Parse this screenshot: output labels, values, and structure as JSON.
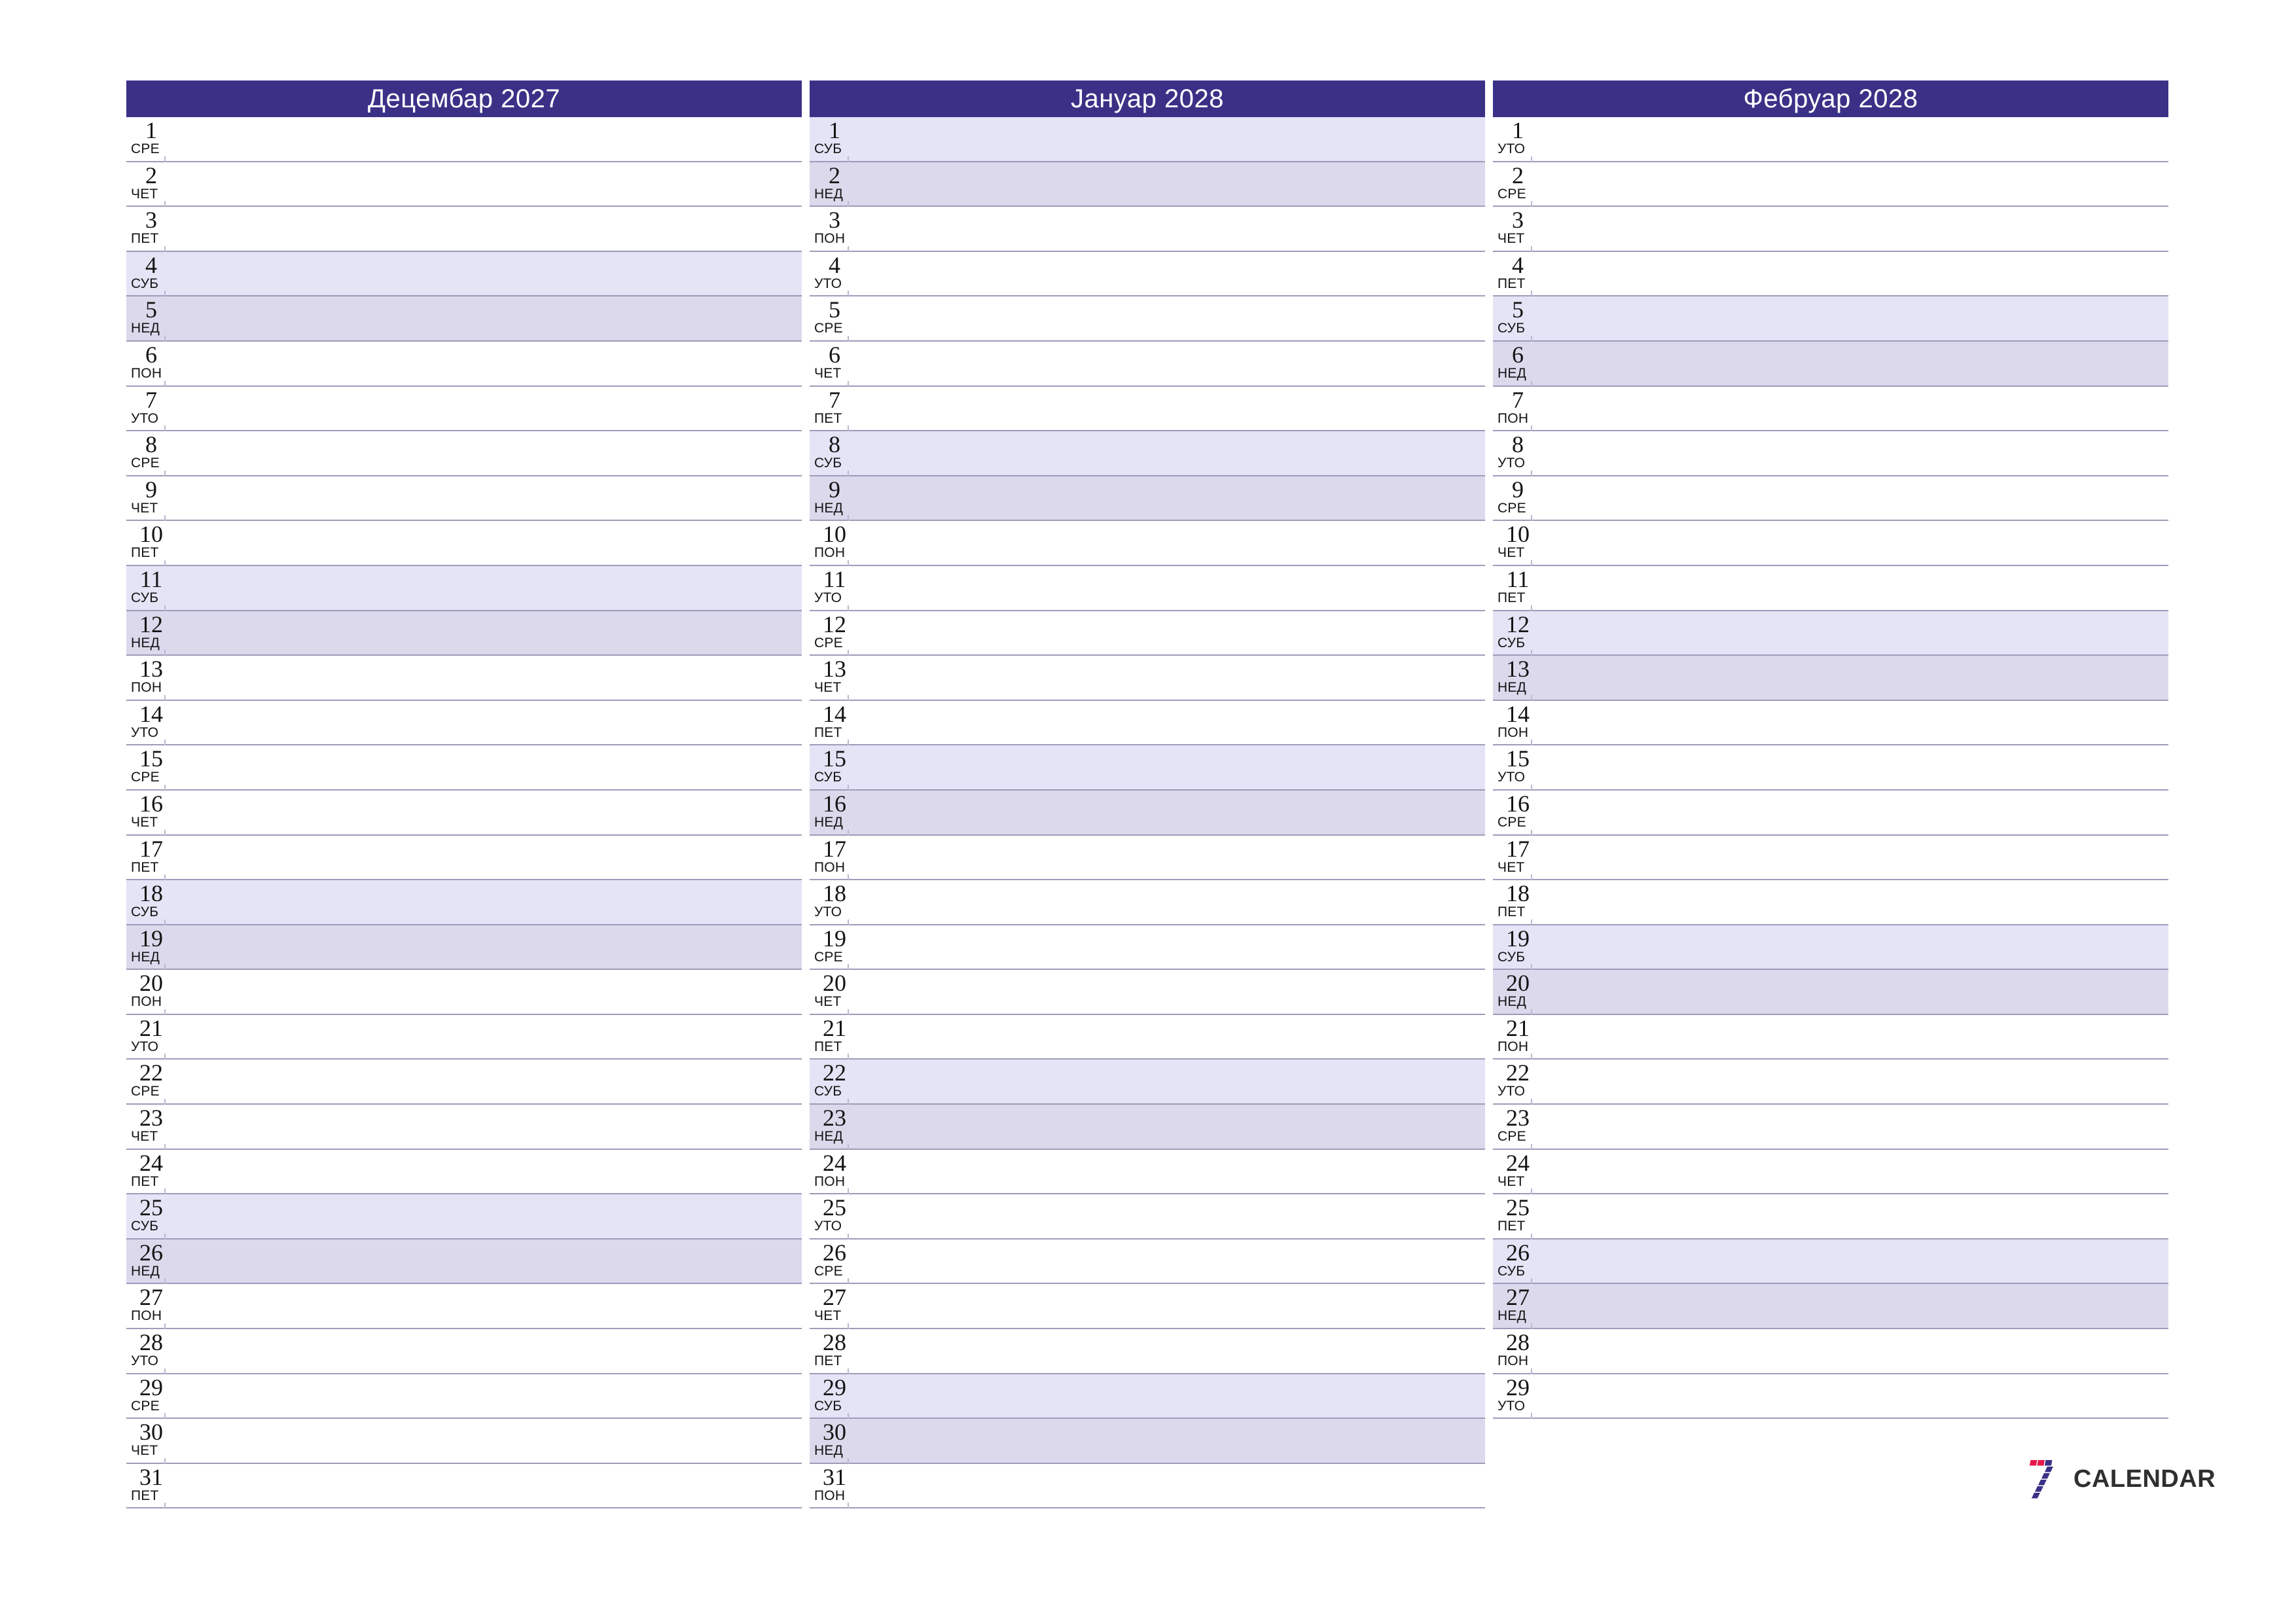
{
  "page": {
    "background": "#ffffff",
    "accent_header": "#3a3187",
    "saturday_tint": "#e4e4f6",
    "sunday_tint": "#dcd9ec",
    "rule_color": "#9c9cba"
  },
  "brand": {
    "name": "CALENDAR",
    "mark": "seven-logo-icon",
    "mark_colors": [
      "#e8174a",
      "#3a3187"
    ]
  },
  "months": [
    {
      "title": "Децембар 2027",
      "month_name": "Децембар",
      "year": "2027",
      "days": [
        {
          "num": "1",
          "dow": "СРЕ",
          "type": "weekday"
        },
        {
          "num": "2",
          "dow": "ЧЕТ",
          "type": "weekday"
        },
        {
          "num": "3",
          "dow": "ПЕТ",
          "type": "weekday"
        },
        {
          "num": "4",
          "dow": "СУБ",
          "type": "sat"
        },
        {
          "num": "5",
          "dow": "НЕД",
          "type": "sun"
        },
        {
          "num": "6",
          "dow": "ПОН",
          "type": "weekday"
        },
        {
          "num": "7",
          "dow": "УТО",
          "type": "weekday"
        },
        {
          "num": "8",
          "dow": "СРЕ",
          "type": "weekday"
        },
        {
          "num": "9",
          "dow": "ЧЕТ",
          "type": "weekday"
        },
        {
          "num": "10",
          "dow": "ПЕТ",
          "type": "weekday"
        },
        {
          "num": "11",
          "dow": "СУБ",
          "type": "sat"
        },
        {
          "num": "12",
          "dow": "НЕД",
          "type": "sun"
        },
        {
          "num": "13",
          "dow": "ПОН",
          "type": "weekday"
        },
        {
          "num": "14",
          "dow": "УТО",
          "type": "weekday"
        },
        {
          "num": "15",
          "dow": "СРЕ",
          "type": "weekday"
        },
        {
          "num": "16",
          "dow": "ЧЕТ",
          "type": "weekday"
        },
        {
          "num": "17",
          "dow": "ПЕТ",
          "type": "weekday"
        },
        {
          "num": "18",
          "dow": "СУБ",
          "type": "sat"
        },
        {
          "num": "19",
          "dow": "НЕД",
          "type": "sun"
        },
        {
          "num": "20",
          "dow": "ПОН",
          "type": "weekday"
        },
        {
          "num": "21",
          "dow": "УТО",
          "type": "weekday"
        },
        {
          "num": "22",
          "dow": "СРЕ",
          "type": "weekday"
        },
        {
          "num": "23",
          "dow": "ЧЕТ",
          "type": "weekday"
        },
        {
          "num": "24",
          "dow": "ПЕТ",
          "type": "weekday"
        },
        {
          "num": "25",
          "dow": "СУБ",
          "type": "sat"
        },
        {
          "num": "26",
          "dow": "НЕД",
          "type": "sun"
        },
        {
          "num": "27",
          "dow": "ПОН",
          "type": "weekday"
        },
        {
          "num": "28",
          "dow": "УТО",
          "type": "weekday"
        },
        {
          "num": "29",
          "dow": "СРЕ",
          "type": "weekday"
        },
        {
          "num": "30",
          "dow": "ЧЕТ",
          "type": "weekday"
        },
        {
          "num": "31",
          "dow": "ПЕТ",
          "type": "weekday"
        }
      ]
    },
    {
      "title": "Јануар 2028",
      "month_name": "Јануар",
      "year": "2028",
      "days": [
        {
          "num": "1",
          "dow": "СУБ",
          "type": "sat"
        },
        {
          "num": "2",
          "dow": "НЕД",
          "type": "sun"
        },
        {
          "num": "3",
          "dow": "ПОН",
          "type": "weekday"
        },
        {
          "num": "4",
          "dow": "УТО",
          "type": "weekday"
        },
        {
          "num": "5",
          "dow": "СРЕ",
          "type": "weekday"
        },
        {
          "num": "6",
          "dow": "ЧЕТ",
          "type": "weekday"
        },
        {
          "num": "7",
          "dow": "ПЕТ",
          "type": "weekday"
        },
        {
          "num": "8",
          "dow": "СУБ",
          "type": "sat"
        },
        {
          "num": "9",
          "dow": "НЕД",
          "type": "sun"
        },
        {
          "num": "10",
          "dow": "ПОН",
          "type": "weekday"
        },
        {
          "num": "11",
          "dow": "УТО",
          "type": "weekday"
        },
        {
          "num": "12",
          "dow": "СРЕ",
          "type": "weekday"
        },
        {
          "num": "13",
          "dow": "ЧЕТ",
          "type": "weekday"
        },
        {
          "num": "14",
          "dow": "ПЕТ",
          "type": "weekday"
        },
        {
          "num": "15",
          "dow": "СУБ",
          "type": "sat"
        },
        {
          "num": "16",
          "dow": "НЕД",
          "type": "sun"
        },
        {
          "num": "17",
          "dow": "ПОН",
          "type": "weekday"
        },
        {
          "num": "18",
          "dow": "УТО",
          "type": "weekday"
        },
        {
          "num": "19",
          "dow": "СРЕ",
          "type": "weekday"
        },
        {
          "num": "20",
          "dow": "ЧЕТ",
          "type": "weekday"
        },
        {
          "num": "21",
          "dow": "ПЕТ",
          "type": "weekday"
        },
        {
          "num": "22",
          "dow": "СУБ",
          "type": "sat"
        },
        {
          "num": "23",
          "dow": "НЕД",
          "type": "sun"
        },
        {
          "num": "24",
          "dow": "ПОН",
          "type": "weekday"
        },
        {
          "num": "25",
          "dow": "УТО",
          "type": "weekday"
        },
        {
          "num": "26",
          "dow": "СРЕ",
          "type": "weekday"
        },
        {
          "num": "27",
          "dow": "ЧЕТ",
          "type": "weekday"
        },
        {
          "num": "28",
          "dow": "ПЕТ",
          "type": "weekday"
        },
        {
          "num": "29",
          "dow": "СУБ",
          "type": "sat"
        },
        {
          "num": "30",
          "dow": "НЕД",
          "type": "sun"
        },
        {
          "num": "31",
          "dow": "ПОН",
          "type": "weekday"
        }
      ]
    },
    {
      "title": "Фебруар 2028",
      "month_name": "Фебруар",
      "year": "2028",
      "days": [
        {
          "num": "1",
          "dow": "УТО",
          "type": "weekday"
        },
        {
          "num": "2",
          "dow": "СРЕ",
          "type": "weekday"
        },
        {
          "num": "3",
          "dow": "ЧЕТ",
          "type": "weekday"
        },
        {
          "num": "4",
          "dow": "ПЕТ",
          "type": "weekday"
        },
        {
          "num": "5",
          "dow": "СУБ",
          "type": "sat"
        },
        {
          "num": "6",
          "dow": "НЕД",
          "type": "sun"
        },
        {
          "num": "7",
          "dow": "ПОН",
          "type": "weekday"
        },
        {
          "num": "8",
          "dow": "УТО",
          "type": "weekday"
        },
        {
          "num": "9",
          "dow": "СРЕ",
          "type": "weekday"
        },
        {
          "num": "10",
          "dow": "ЧЕТ",
          "type": "weekday"
        },
        {
          "num": "11",
          "dow": "ПЕТ",
          "type": "weekday"
        },
        {
          "num": "12",
          "dow": "СУБ",
          "type": "sat"
        },
        {
          "num": "13",
          "dow": "НЕД",
          "type": "sun"
        },
        {
          "num": "14",
          "dow": "ПОН",
          "type": "weekday"
        },
        {
          "num": "15",
          "dow": "УТО",
          "type": "weekday"
        },
        {
          "num": "16",
          "dow": "СРЕ",
          "type": "weekday"
        },
        {
          "num": "17",
          "dow": "ЧЕТ",
          "type": "weekday"
        },
        {
          "num": "18",
          "dow": "ПЕТ",
          "type": "weekday"
        },
        {
          "num": "19",
          "dow": "СУБ",
          "type": "sat"
        },
        {
          "num": "20",
          "dow": "НЕД",
          "type": "sun"
        },
        {
          "num": "21",
          "dow": "ПОН",
          "type": "weekday"
        },
        {
          "num": "22",
          "dow": "УТО",
          "type": "weekday"
        },
        {
          "num": "23",
          "dow": "СРЕ",
          "type": "weekday"
        },
        {
          "num": "24",
          "dow": "ЧЕТ",
          "type": "weekday"
        },
        {
          "num": "25",
          "dow": "ПЕТ",
          "type": "weekday"
        },
        {
          "num": "26",
          "dow": "СУБ",
          "type": "sat"
        },
        {
          "num": "27",
          "dow": "НЕД",
          "type": "sun"
        },
        {
          "num": "28",
          "dow": "ПОН",
          "type": "weekday"
        },
        {
          "num": "29",
          "dow": "УТО",
          "type": "weekday"
        }
      ]
    }
  ]
}
